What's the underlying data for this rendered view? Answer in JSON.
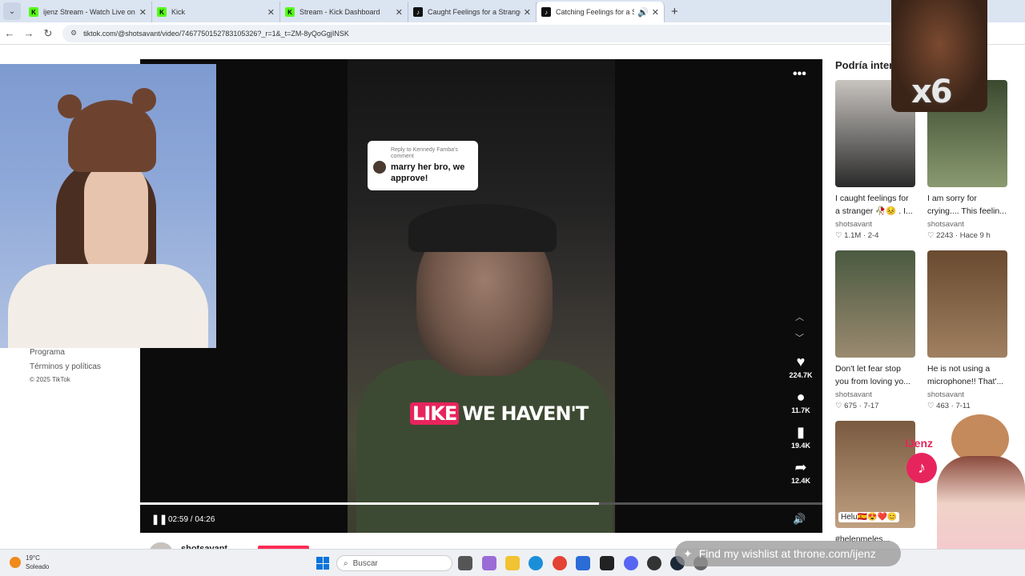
{
  "browser": {
    "tabs": [
      {
        "title": "ijenz Stream - Watch Live on Ki",
        "icon": "kick-icon",
        "active": false
      },
      {
        "title": "Kick",
        "icon": "kick-icon",
        "active": false
      },
      {
        "title": "Stream - Kick Dashboard",
        "icon": "kick-icon",
        "active": false
      },
      {
        "title": "Caught Feelings for a Stranger",
        "icon": "tiktok-icon",
        "active": false
      },
      {
        "title": "Catching Feelings for a Stra",
        "icon": "tiktok-icon",
        "active": true
      }
    ],
    "url": "tiktok.com/@shotsavant/video/7467750152783105326?_r=1&_t=ZM-8yQoGgjINSK"
  },
  "sidebar": {
    "links": [
      "Programa",
      "Términos y políticas"
    ],
    "copyright": "© 2025 TikTok"
  },
  "video": {
    "comment_reply_to": "Reply to Kennedy Famba's comment",
    "comment_text": "marry her bro, we approve!",
    "subtitle_highlight": "LIKE",
    "subtitle_rest": "WE HAVEN'T",
    "likes": "224.7K",
    "comments": "11.7K",
    "saves": "19.4K",
    "shares": "12.4K",
    "time": "02:59 / 04:26",
    "progress": 0.673,
    "author": "shotsavant"
  },
  "suggestions": {
    "title": "Podría intere",
    "cards": [
      {
        "title": "I caught feelings for a stranger 🥀😣 . I...",
        "author": "shotsavant",
        "stats": "♡ 1.1M · 2-4",
        "colors": [
          "#c8c4c0",
          "#2a2a2a"
        ]
      },
      {
        "title": "I am sorry for crying.... This feelin...",
        "author": "shotsavant",
        "stats": "♡ 2243 · Hace 9 h",
        "colors": [
          "#3b4a30",
          "#8a9a70"
        ]
      },
      {
        "title": "Don't let fear stop you from loving yo...",
        "author": "shotsavant",
        "stats": "♡ 675 · 7-17",
        "colors": [
          "#4a5a40",
          "#9a8a70"
        ]
      },
      {
        "title": "He is not using a microphone!! That'...",
        "author": "shotsavant",
        "stats": "♡ 463 · 7-11",
        "colors": [
          "#6a4a30",
          "#a08060"
        ]
      },
      {
        "title": "#helenmeles...",
        "author": "",
        "stats": "",
        "colors": [
          "#7a5a40",
          "#c0a080"
        ]
      }
    ],
    "helu_text": "Helu🇪🇸😍❤️😊"
  },
  "overlays": {
    "x6": "x6",
    "streamer_name": "IJenz",
    "wishlist": "Find my wishlist at throne.com/ijenz"
  },
  "taskbar": {
    "temperature": "19°C",
    "weather": "Soleado",
    "search_placeholder": "Buscar"
  }
}
